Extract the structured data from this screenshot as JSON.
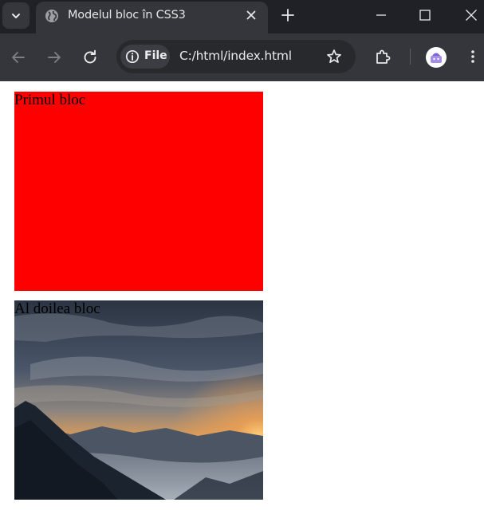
{
  "browser": {
    "tab": {
      "title": "Modelul bloc în CSS3",
      "icon": "globe-icon"
    },
    "address_bar": {
      "security_chip": "File",
      "url": "C:/html/index.html"
    },
    "colors": {
      "titlebar": "#1f2126",
      "toolbar": "#35363b",
      "omnibox": "#28292d"
    }
  },
  "page": {
    "blocks": [
      {
        "label": "Primul bloc",
        "background": "#ff0000"
      },
      {
        "label": "Al doilea bloc",
        "background": "mountain-sunset-image"
      }
    ]
  }
}
